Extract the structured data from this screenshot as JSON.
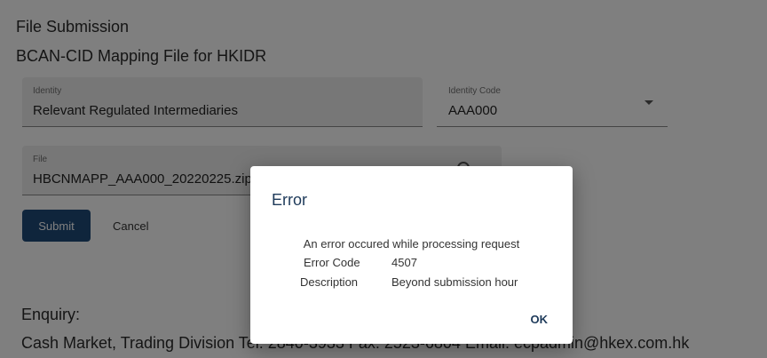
{
  "page": {
    "heading": "File Submission",
    "subheading": "BCAN-CID Mapping File for HKIDR"
  },
  "form": {
    "identity": {
      "label": "Identity",
      "value": "Relevant Regulated Intermediaries"
    },
    "identity_code": {
      "label": "Identity Code",
      "value": "AAA000"
    },
    "file": {
      "label": "File",
      "value": "HBCNMAPP_AAA000_20220225.zip"
    },
    "submit_label": "Submit",
    "cancel_label": "Cancel"
  },
  "footer": {
    "enquiry_label": "Enquiry:",
    "contact": "Cash Market, Trading Division Tel: 2840-3933 Fax: 2523-6804 Email: ecpadmin@hkex.com.hk"
  },
  "dialog": {
    "title": "Error",
    "message": "An error occured while processing request",
    "details": [
      {
        "label": "Error Code",
        "value": "4507"
      },
      {
        "label": "Description",
        "value": "Beyond submission hour"
      }
    ],
    "ok_label": "OK"
  },
  "colors": {
    "primary_button": "#1e4a78",
    "dialog_title": "#1e3a5a",
    "overlay": "rgba(0,0,0,0.5)"
  }
}
